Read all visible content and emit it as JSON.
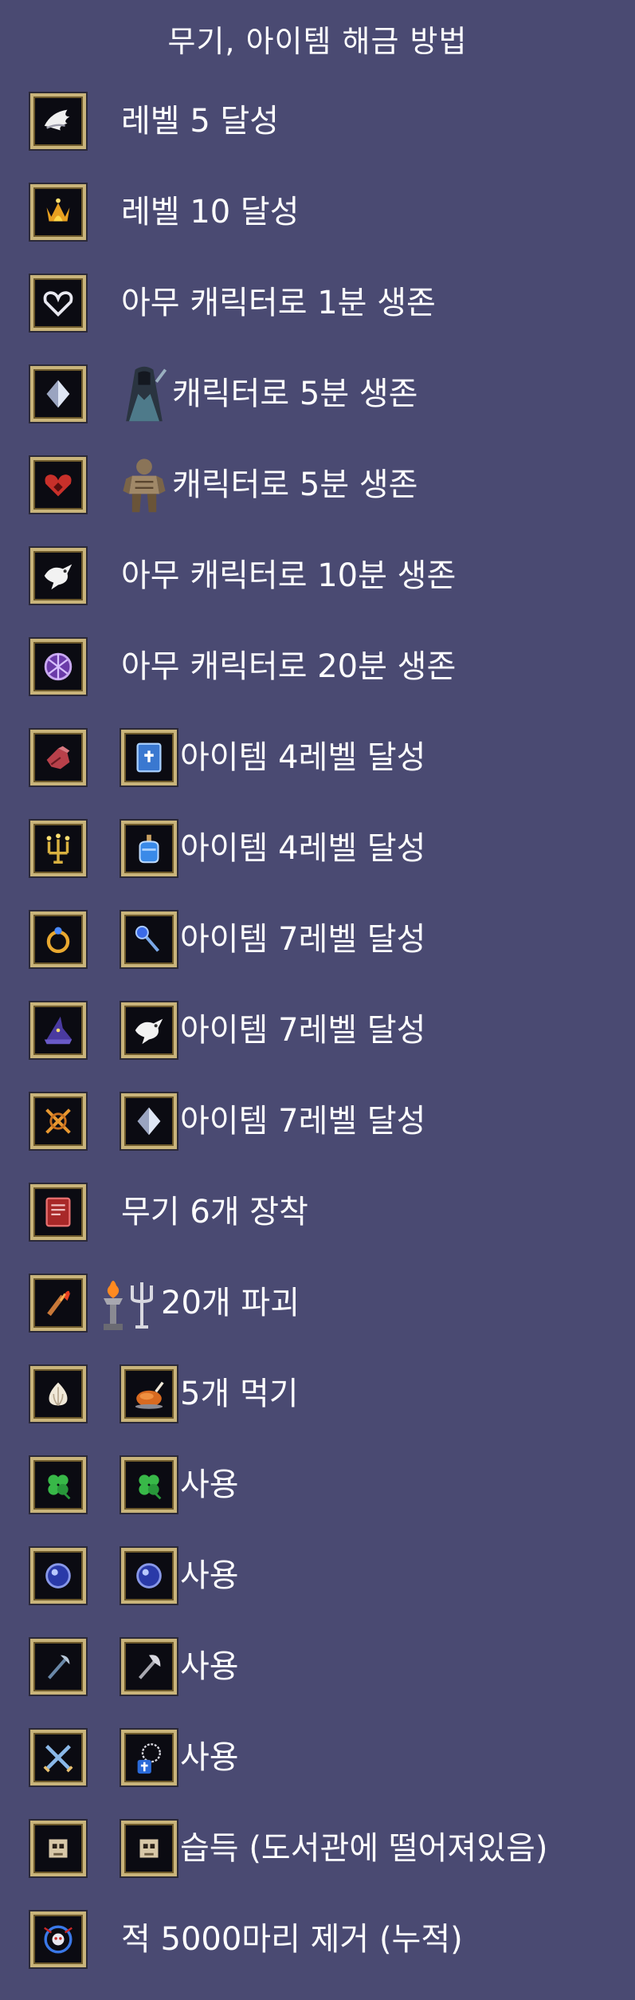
{
  "title": "무기, 아이템 해금 방법",
  "rows": [
    {
      "icon": "wings-icon",
      "text": "레벨 5 달성"
    },
    {
      "icon": "crown-flame-icon",
      "text": "레벨 10 달성"
    },
    {
      "icon": "heart-outline-icon",
      "text": "아무 캐릭터로 1분 생존"
    },
    {
      "icon": "diamond-icon",
      "sprite": "hooded-character-sprite",
      "text": "캐릭터로 5분 생존"
    },
    {
      "icon": "red-heart-icon",
      "sprite": "mummy-character-sprite",
      "text": "캐릭터로 5분 생존"
    },
    {
      "icon": "dove-icon",
      "text": "아무 캐릭터로 10분 생존"
    },
    {
      "icon": "purple-orb-icon",
      "text": "아무 캐릭터로 20분 생존"
    },
    {
      "icon": "gauntlet-icon",
      "icon2": "blue-book-icon",
      "text": "아이템 4레벨 달성"
    },
    {
      "icon": "candelabra-icon",
      "icon2": "blue-potion-icon",
      "text": "아이템 4레벨 달성"
    },
    {
      "icon": "ring-icon",
      "icon2": "magic-wand-icon",
      "text": "아이템 7레벨 달성"
    },
    {
      "icon": "wizard-hat-icon",
      "icon2": "dove-icon",
      "text": "아이템 7레벨 달성"
    },
    {
      "icon": "cross-sigil-icon",
      "icon2": "diamond-icon",
      "text": "아이템 7레벨 달성"
    },
    {
      "icon": "red-tome-icon",
      "text": "무기 6개 장착"
    },
    {
      "icon": "fire-wand-icon",
      "sprite": "brazier-candelabra-sprite",
      "text": "20개 파괴"
    },
    {
      "icon": "garlic-icon",
      "icon2": "roast-chicken-icon",
      "text": "5개 먹기"
    },
    {
      "icon": "clover-icon",
      "icon2": "clover-icon",
      "text": "사용"
    },
    {
      "icon": "blue-orb-icon",
      "icon2": "blue-orb-icon",
      "text": "사용"
    },
    {
      "icon": "axe-icon",
      "icon2": "axe-icon",
      "text": "사용"
    },
    {
      "icon": "crossed-swords-icon",
      "icon2": "rosary-icon",
      "text": "사용"
    },
    {
      "icon": "skull-box-icon",
      "icon2": "skull-box-icon",
      "text": "습득 (도서관에 떨어져있음)"
    },
    {
      "icon": "chaos-skull-icon",
      "text": "적 5000마리 제거 (누적)"
    }
  ]
}
